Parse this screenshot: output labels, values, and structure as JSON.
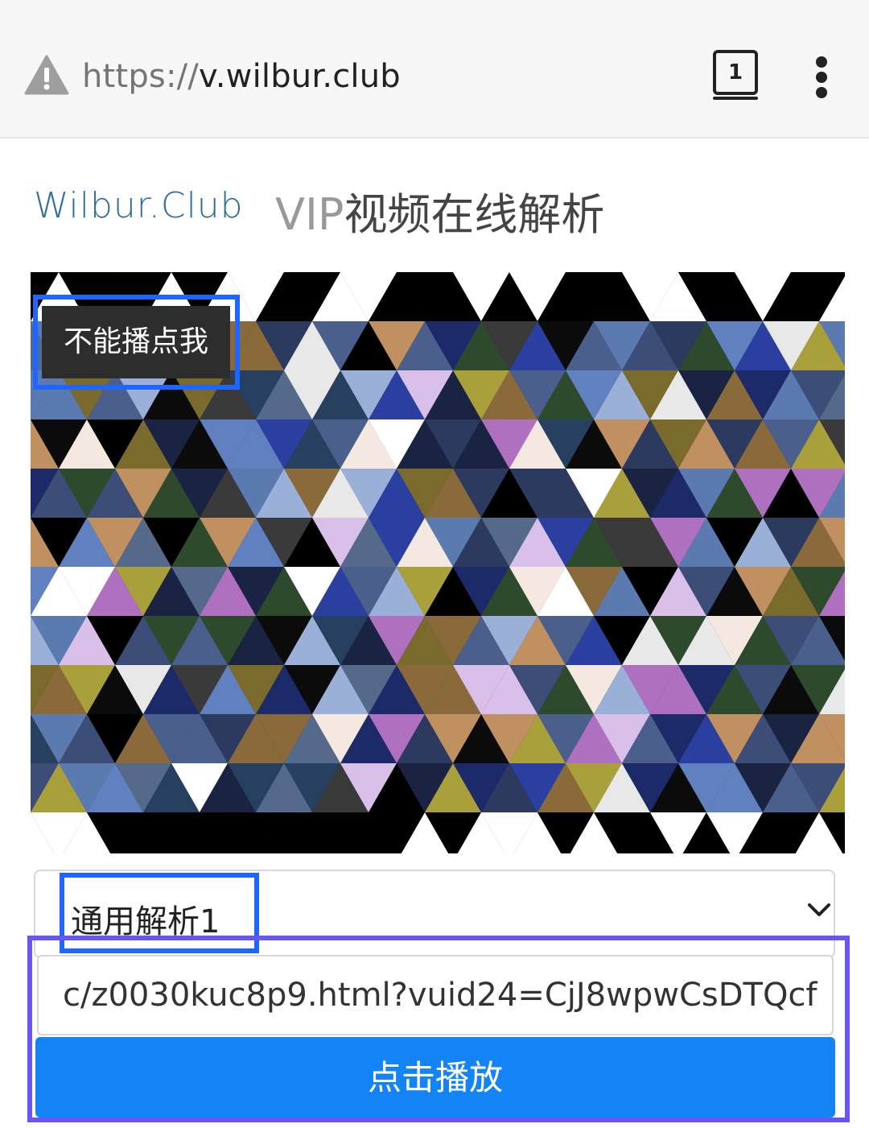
{
  "browser": {
    "url_scheme": "https://",
    "url_host": "v.wilbur.club",
    "tab_count": "1",
    "icons": [
      "warning-icon",
      "tabs-icon",
      "overflow-menu-icon"
    ]
  },
  "header": {
    "brand": "Wilbur.Club",
    "title_prefix": "VIP",
    "title_rest": "视频在线解析"
  },
  "video": {
    "cant_play_label": "不能播点我"
  },
  "form": {
    "select_value": "通用解析1",
    "url_value": "c/z0030kuc8p9.html?vuid24=CjJ8wpwCsDTQcf",
    "play_label": "点击播放"
  },
  "colors": {
    "accent_blue": "#1383f6",
    "highlight_blue": "#1e66ff",
    "highlight_purple": "#6a55f0",
    "brand_text": "#2f6f9a"
  }
}
